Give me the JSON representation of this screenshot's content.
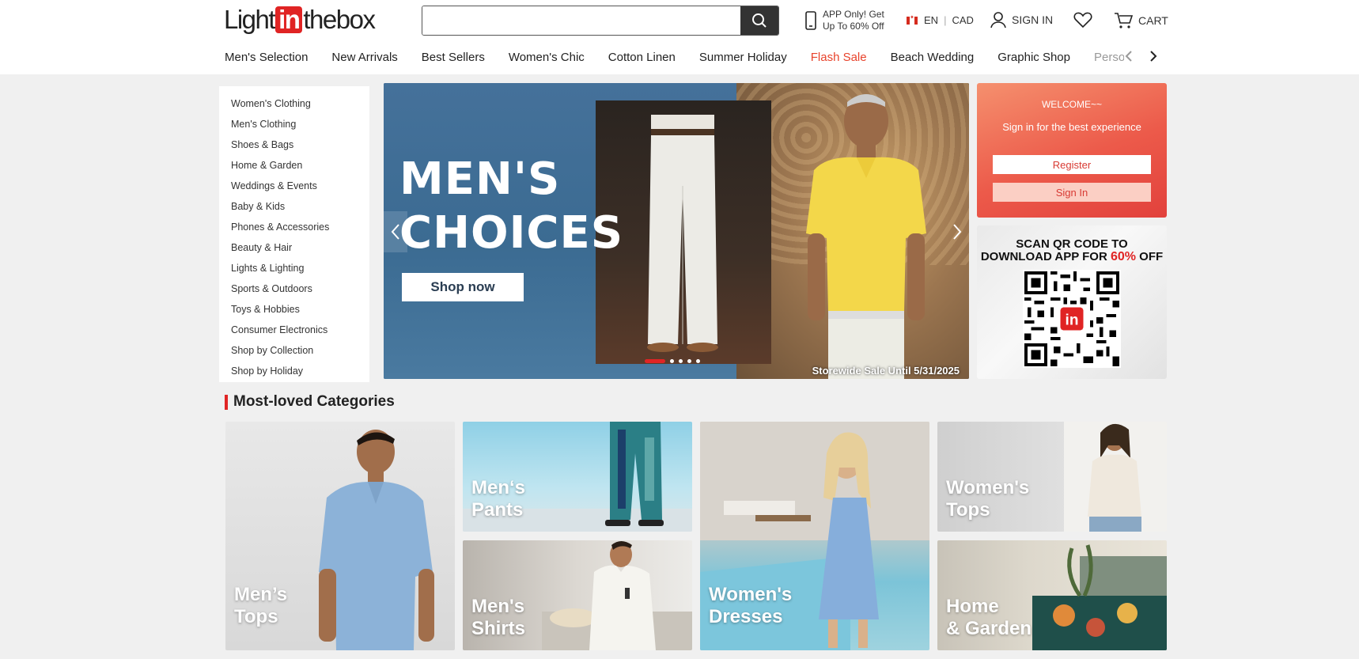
{
  "brand": {
    "logo_pre": "Light",
    "logo_in": "in",
    "logo_post": "thebox"
  },
  "search": {
    "placeholder": "",
    "value": ""
  },
  "header": {
    "app_promo_line1": "APP Only! Get",
    "app_promo_line2": "Up To 60% Off",
    "language": "EN",
    "currency": "CAD",
    "sign_in": "SIGN IN",
    "cart": "CART"
  },
  "nav": {
    "items": [
      "Men's Selection",
      "New Arrivals",
      "Best Sellers",
      "Women's Chic",
      "Cotton Linen",
      "Summer Holiday",
      "Flash Sale",
      "Beach Wedding",
      "Graphic Shop",
      "Personalized"
    ]
  },
  "categories": [
    "Women's Clothing",
    "Men's Clothing",
    "Shoes & Bags",
    "Home & Garden",
    "Weddings & Events",
    "Baby & Kids",
    "Phones & Accessories",
    "Beauty & Hair",
    "Lights & Lighting",
    "Sports & Outdoors",
    "Toys & Hobbies",
    "Consumer Electronics",
    "Shop by Collection",
    "Shop by Holiday"
  ],
  "hero": {
    "title_line1": "MEN'S",
    "title_line2": "CHOICES",
    "cta": "Shop now",
    "sale_note": "Storewide Sale Until 5/31/2025",
    "slide_count": 5,
    "active_slide": 1
  },
  "welcome": {
    "greeting": "WELCOME~~",
    "subtitle": "Sign in for the best experience",
    "register": "Register",
    "sign_in": "Sign In"
  },
  "qr": {
    "line1": "SCAN QR CODE TO",
    "line2_pre": "DOWNLOAD APP FOR ",
    "line2_highlight": "60%",
    "line2_post": " OFF"
  },
  "most_loved": {
    "title": "Most-loved Categories",
    "tiles": [
      {
        "line1": "Men’s",
        "line2": "Tops"
      },
      {
        "line1": "Men‘s",
        "line2": "Pants"
      },
      {
        "line1": "Men's",
        "line2": "Shirts"
      },
      {
        "line1": "Women's",
        "line2": "Dresses"
      },
      {
        "line1": "Women's",
        "line2": "Tops"
      },
      {
        "line1": "Home",
        "line2": "& Garden"
      }
    ]
  },
  "colors": {
    "accent": "#e02424",
    "flash_sale": "#e8432c",
    "welcome_bg": "#ec5a4a"
  }
}
